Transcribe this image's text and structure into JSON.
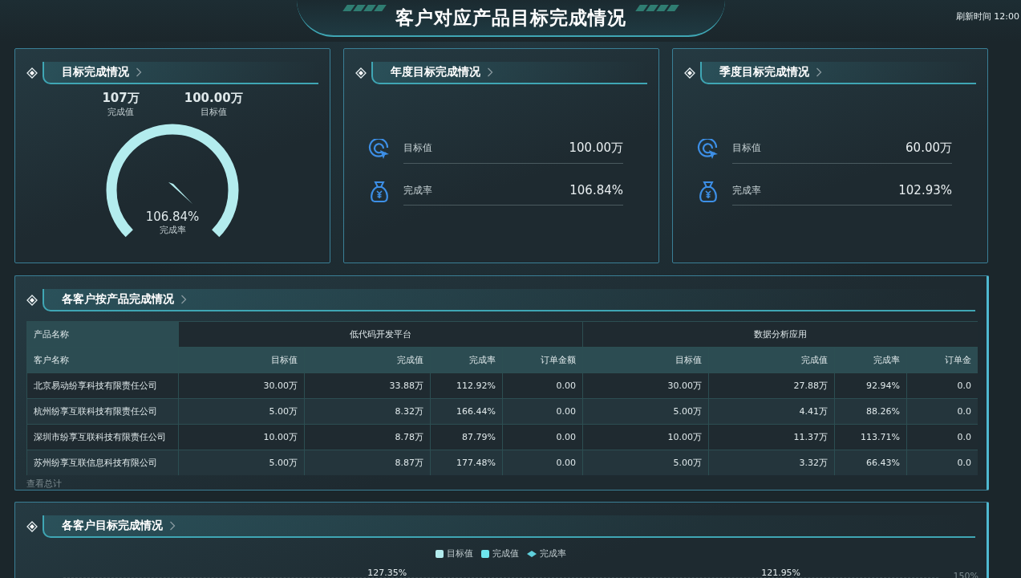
{
  "header": {
    "title": "客户对应产品目标完成情况",
    "refresh": "刷新时间 12:00"
  },
  "goal_card": {
    "title": "目标完成情况",
    "stats": [
      {
        "value": "107万",
        "label": "完成值"
      },
      {
        "value": "100.00万",
        "label": "目标值"
      }
    ],
    "gauge": {
      "level": 1,
      "value": "106.84%",
      "label": "完成率"
    }
  },
  "summary_cards": [
    {
      "title": "年度目标完成情况",
      "rows": [
        {
          "kind": "target",
          "label": "目标值",
          "value": "100.00万"
        },
        {
          "kind": "money",
          "label": "完成率",
          "value": "106.84%"
        }
      ]
    },
    {
      "title": "季度目标完成情况",
      "rows": [
        {
          "kind": "target",
          "label": "目标值",
          "value": "60.00万"
        },
        {
          "kind": "money",
          "label": "完成率",
          "value": "102.93%"
        }
      ]
    }
  ],
  "table_card": {
    "title": "各客户按产品完成情况",
    "corner_top": "产品名称",
    "corner_bottom": "客户名称",
    "groups": [
      "低代码开发平台",
      "数据分析应用"
    ],
    "columns": [
      "目标值",
      "完成值",
      "完成率",
      "订单金额",
      "目标值",
      "完成值",
      "完成率",
      "订单金"
    ],
    "rows": [
      {
        "customer": "北京易动纷享科技有限责任公司",
        "cells": [
          "30.00万",
          "33.88万",
          "112.92%",
          "0.00",
          "30.00万",
          "27.88万",
          "92.94%",
          "0.0"
        ]
      },
      {
        "customer": "杭州纷享互联科技有限责任公司",
        "cells": [
          "5.00万",
          "8.32万",
          "166.44%",
          "0.00",
          "5.00万",
          "4.41万",
          "88.26%",
          "0.0"
        ]
      },
      {
        "customer": "深圳市纷享互联科技有限责任公司",
        "cells": [
          "10.00万",
          "8.78万",
          "87.79%",
          "0.00",
          "10.00万",
          "11.37万",
          "113.71%",
          "0.0"
        ]
      },
      {
        "customer": "苏州纷享互联信息科技有限公司",
        "cells": [
          "5.00万",
          "8.87万",
          "177.48%",
          "0.00",
          "5.00万",
          "3.32万",
          "66.43%",
          "0.0"
        ]
      }
    ],
    "footer": "查看总计"
  },
  "chart_card": {
    "title": "各客户目标完成情况",
    "legend": [
      {
        "kind": "square",
        "label": "目标值",
        "color": "#b3ecee"
      },
      {
        "kind": "square",
        "label": "完成值",
        "color": "#6ee6ee"
      },
      {
        "kind": "line",
        "label": "完成率",
        "color": "#5fd0dc"
      }
    ],
    "labels": [
      "127.35%",
      "121.95%"
    ],
    "y_tick": "150%"
  }
}
